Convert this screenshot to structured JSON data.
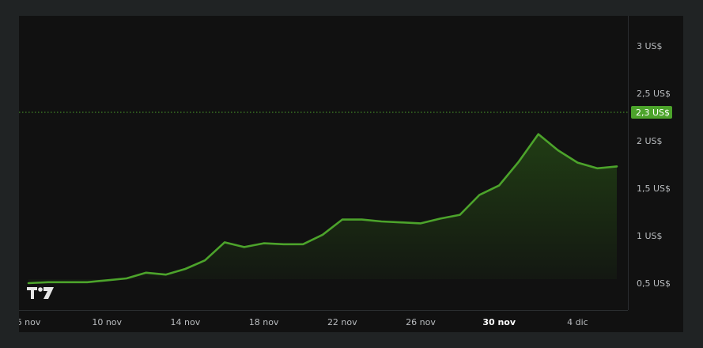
{
  "chart_data": {
    "type": "area",
    "x": [
      "6 nov",
      "7 nov",
      "8 nov",
      "9 nov",
      "10 nov",
      "11 nov",
      "12 nov",
      "13 nov",
      "14 nov",
      "15 nov",
      "16 nov",
      "17 nov",
      "18 nov",
      "19 nov",
      "20 nov",
      "21 nov",
      "22 nov",
      "23 nov",
      "24 nov",
      "25 nov",
      "26 nov",
      "27 nov",
      "28 nov",
      "29 nov",
      "30 nov",
      "1 dic",
      "2 dic",
      "3 dic",
      "4 dic",
      "5 dic",
      "5.5 dic"
    ],
    "x_index": [
      0,
      1,
      2,
      3,
      4,
      5,
      6,
      7,
      8,
      9,
      10,
      11,
      12,
      13,
      14,
      15,
      16,
      17,
      18,
      19,
      20,
      21,
      22,
      23,
      24,
      25,
      26,
      27,
      28,
      29,
      30
    ],
    "series": [
      {
        "values": [
          0.5,
          0.51,
          0.51,
          0.51,
          0.53,
          0.55,
          0.61,
          0.59,
          0.65,
          0.74,
          0.93,
          0.88,
          0.92,
          0.91,
          0.91,
          1.01,
          1.17,
          1.17,
          1.15,
          1.14,
          1.13,
          1.18,
          1.22,
          1.43,
          1.53,
          1.78,
          2.07,
          1.9,
          1.77,
          1.71,
          1.73
        ],
        "color": "#4ca32b"
      }
    ],
    "last_value": 2.3,
    "last_value_label": "2,3 US$",
    "xticks": [
      {
        "label": "6 nov",
        "x": 0,
        "bold": false
      },
      {
        "label": "10 nov",
        "x": 4,
        "bold": false
      },
      {
        "label": "14 nov",
        "x": 8,
        "bold": false
      },
      {
        "label": "18 nov",
        "x": 12,
        "bold": false
      },
      {
        "label": "22 nov",
        "x": 16,
        "bold": false
      },
      {
        "label": "26 nov",
        "x": 20,
        "bold": false
      },
      {
        "label": "30 nov",
        "x": 24,
        "bold": true
      },
      {
        "label": "4 dic",
        "x": 28,
        "bold": false
      }
    ],
    "yticks": [
      {
        "label": "0,5 US$",
        "value": 0.5
      },
      {
        "label": "1 US$",
        "value": 1.0
      },
      {
        "label": "1,5 US$",
        "value": 1.5
      },
      {
        "label": "2 US$",
        "value": 2.0
      },
      {
        "label": "2,5 US$",
        "value": 2.5
      },
      {
        "label": "3 US$",
        "value": 3.0
      }
    ],
    "ylim": [
      0.5,
      3.25
    ],
    "grid": false,
    "accent_color": "#4ca32b",
    "background_color": "#111111",
    "logo": "tradingview-logo"
  }
}
